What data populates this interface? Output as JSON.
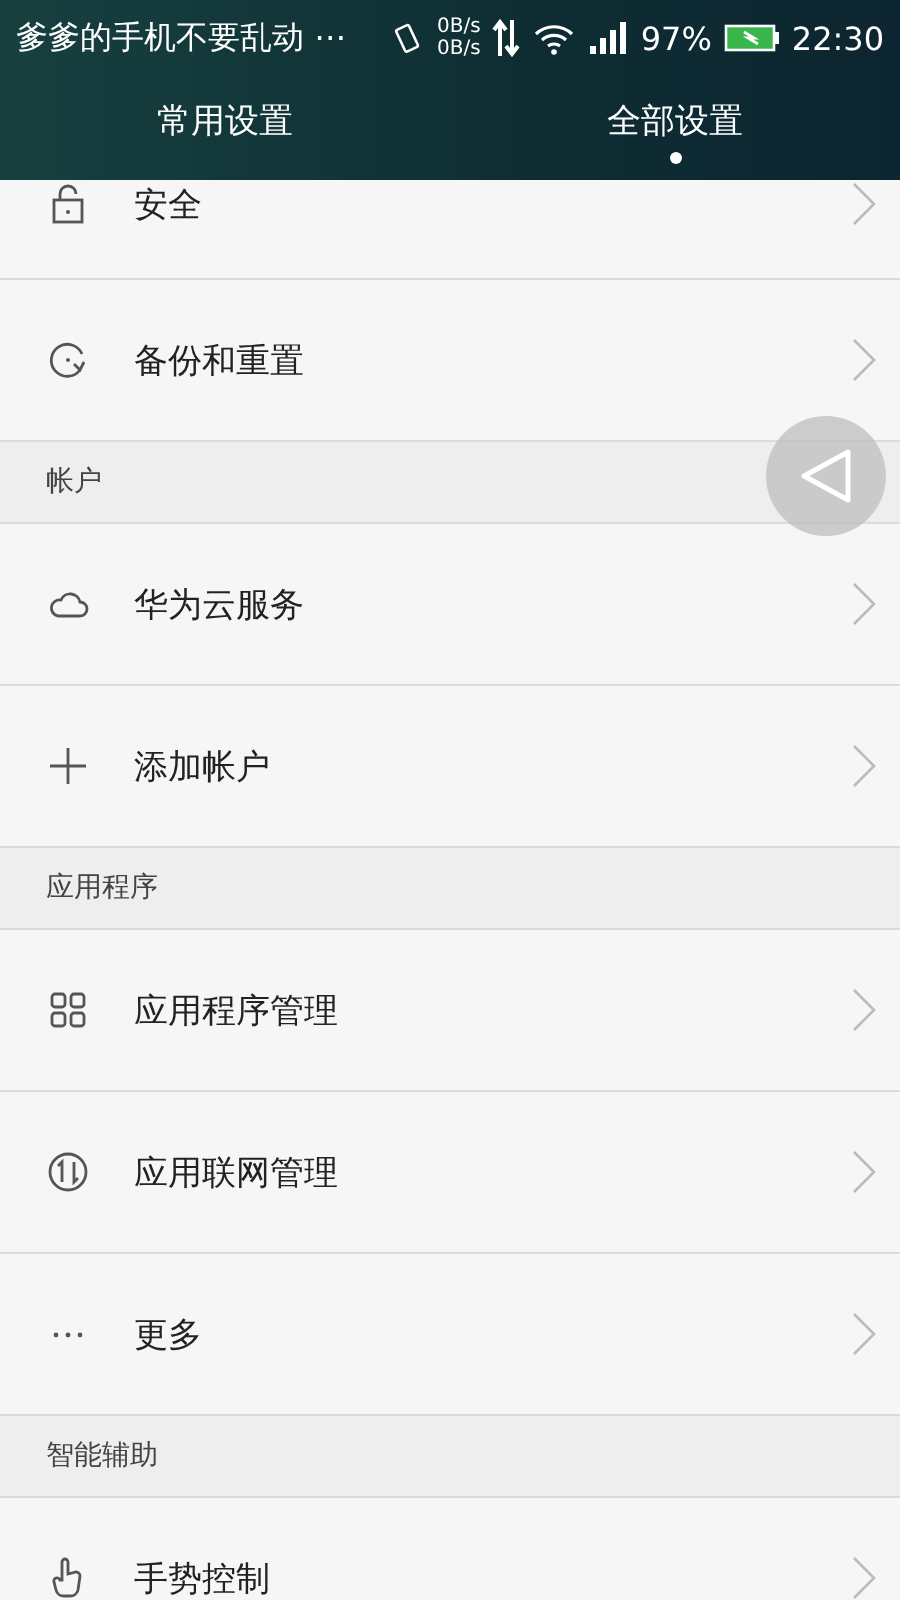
{
  "status_bar": {
    "notification": "爹爹的手机不要乱动 ⋯",
    "speed_up": "0B/s",
    "speed_down": "0B/s",
    "battery": "97%",
    "time": "22:30"
  },
  "tabs": [
    {
      "label": "常用设置",
      "selected": false
    },
    {
      "label": "全部设置",
      "selected": true
    }
  ],
  "list": [
    {
      "kind": "lock",
      "label": "安全"
    },
    {
      "kind": "backup",
      "label": "备份和重置"
    },
    {
      "kind": "header",
      "label": "帐户"
    },
    {
      "kind": "cloud",
      "label": "华为云服务"
    },
    {
      "kind": "plus",
      "label": "添加帐户"
    },
    {
      "kind": "header",
      "label": "应用程序"
    },
    {
      "kind": "grid",
      "label": "应用程序管理"
    },
    {
      "kind": "network",
      "label": "应用联网管理"
    },
    {
      "kind": "dots",
      "label": "更多"
    },
    {
      "kind": "header",
      "label": "智能辅助"
    },
    {
      "kind": "hand",
      "label": "手势控制"
    }
  ]
}
